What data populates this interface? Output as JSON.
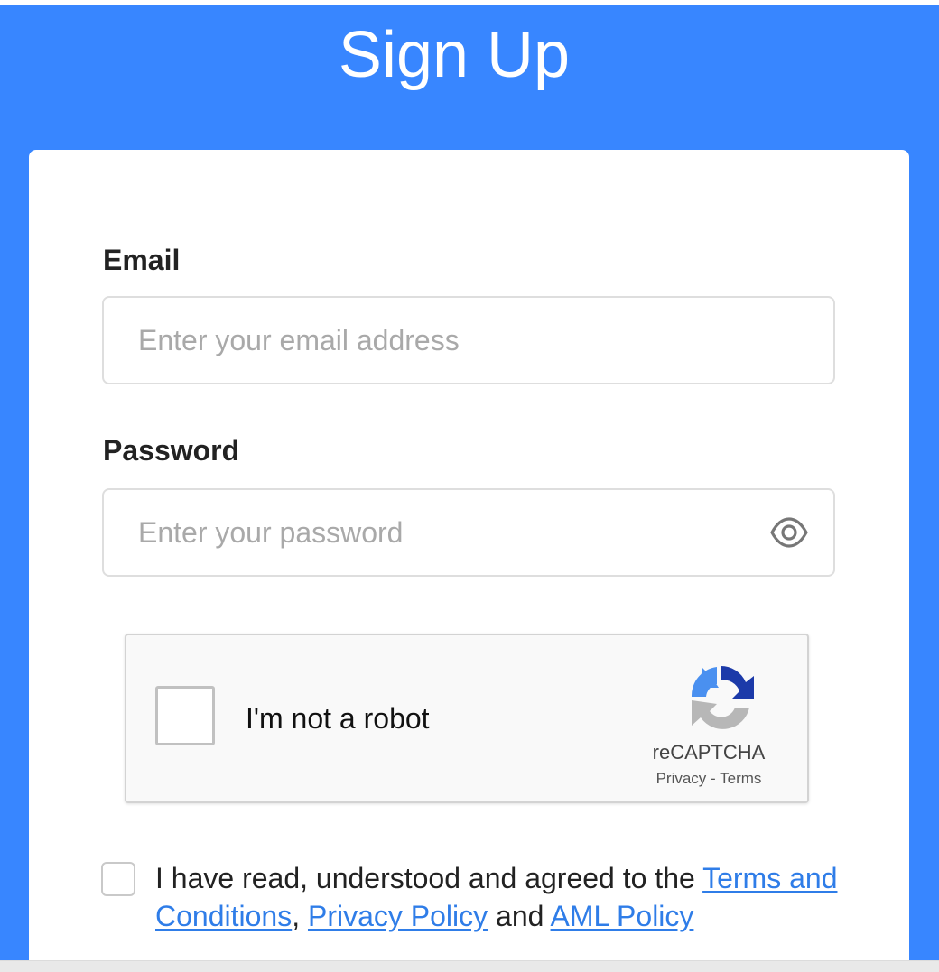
{
  "header": {
    "title": "Sign Up"
  },
  "form": {
    "email": {
      "label": "Email",
      "placeholder": "Enter your email address",
      "value": ""
    },
    "password": {
      "label": "Password",
      "placeholder": "Enter your password",
      "value": "",
      "toggle_icon": "eye-icon"
    }
  },
  "captcha": {
    "label": "I'm not a robot",
    "brand": "reCAPTCHA",
    "privacy_link": "Privacy",
    "separator": " - ",
    "terms_link": "Terms",
    "checked": false,
    "logo_icon": "recaptcha-logo-icon"
  },
  "agreement": {
    "checked": false,
    "text_prefix": "I have read, understood and agreed to the ",
    "terms_link": "Terms and Conditions",
    "comma": ", ",
    "privacy_link": "Privacy Policy",
    "and_text": " and ",
    "aml_link": "AML Policy"
  },
  "colors": {
    "primary_blue": "#3886ff",
    "link_blue": "#2f7de8",
    "card_background": "#ffffff",
    "input_border": "#dedede",
    "placeholder": "#a9a9a9"
  }
}
